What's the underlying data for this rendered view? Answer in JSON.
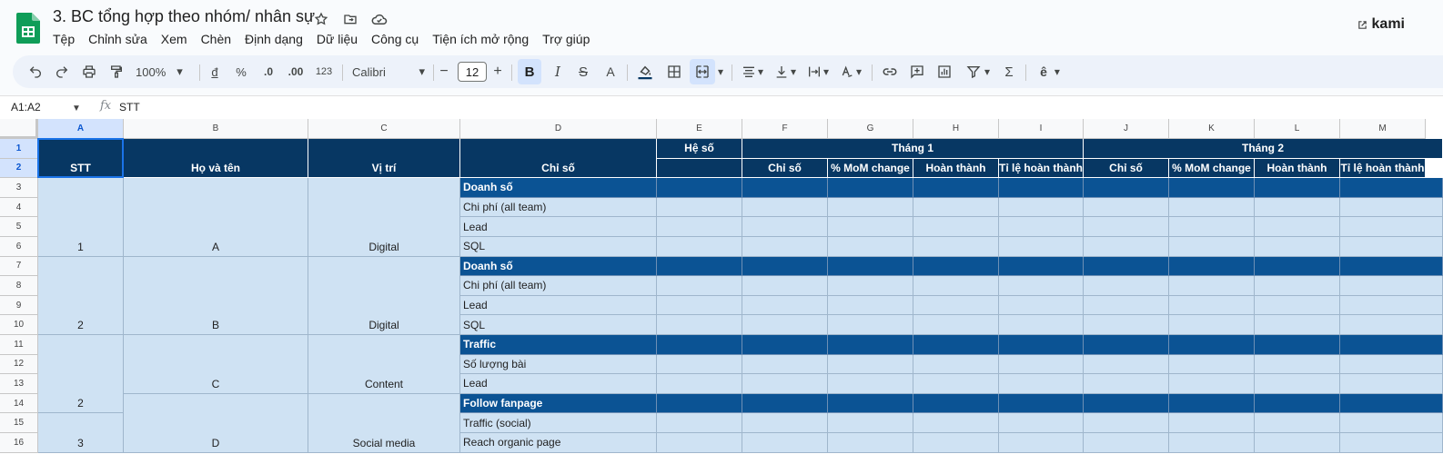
{
  "app": {
    "doc_title": "3. BC tổng hợp theo nhóm/ nhân sự",
    "menu": [
      "Tệp",
      "Chỉnh sửa",
      "Xem",
      "Chèn",
      "Định dạng",
      "Dữ liệu",
      "Công cụ",
      "Tiện ích mở rộng",
      "Trợ giúp"
    ],
    "extension_label": "kami"
  },
  "toolbar": {
    "zoom": "100%",
    "currency": "đ",
    "percent": "%",
    "dec_decrease": ".0",
    "dec_increase": ".00",
    "number_format": "123",
    "font": "Calibri",
    "font_size": "12",
    "minus": "−",
    "plus": "+",
    "bold": "B",
    "italic": "I",
    "strike": "S",
    "text_color": "A"
  },
  "formula_bar": {
    "name_box": "A1:A2",
    "fx": "fx",
    "value": "STT"
  },
  "colors": {
    "header_dark": "#073763",
    "section_blue": "#0b5394",
    "cell_light": "#cfe2f3",
    "selection": "#1a73e8"
  },
  "grid": {
    "columns": [
      "A",
      "B",
      "C",
      "D",
      "E",
      "F",
      "G",
      "H",
      "I",
      "J",
      "K",
      "L",
      "M"
    ],
    "rows": [
      "1",
      "2",
      "3",
      "4",
      "5",
      "6",
      "7",
      "8",
      "9",
      "10",
      "11",
      "12",
      "13",
      "14",
      "15",
      "16"
    ],
    "header": {
      "stt": "STT",
      "name": "Họ và tên",
      "position": "Vị trí",
      "metric": "Chỉ số",
      "coef": "Hệ số",
      "month1": "Tháng 1",
      "month2": "Tháng 2",
      "sub": [
        "Chỉ số",
        "% MoM change",
        "Hoàn thành",
        "Tỉ lệ hoàn thành",
        "Chỉ số",
        "% MoM change",
        "Hoàn thành",
        "Tỉ lệ hoàn thành"
      ]
    },
    "groups": {
      "g1": {
        "stt": "1",
        "name": "A",
        "position": "Digital"
      },
      "g2": {
        "stt": "2",
        "name": "B",
        "position": "Digital"
      },
      "g3": {
        "stt": "2",
        "name": "C",
        "position": "Content"
      },
      "g4": {
        "stt": "3",
        "name": "D",
        "position": "Social media"
      }
    },
    "metrics": [
      "Doanh số",
      "Chi phí (all team)",
      "Lead",
      "SQL",
      "Doanh số",
      "Chi phí (all team)",
      "Lead",
      "SQL",
      "Traffic",
      "Số lượng bài",
      "Lead",
      "Follow fanpage",
      "Traffic (social)",
      "Reach organic page"
    ]
  }
}
